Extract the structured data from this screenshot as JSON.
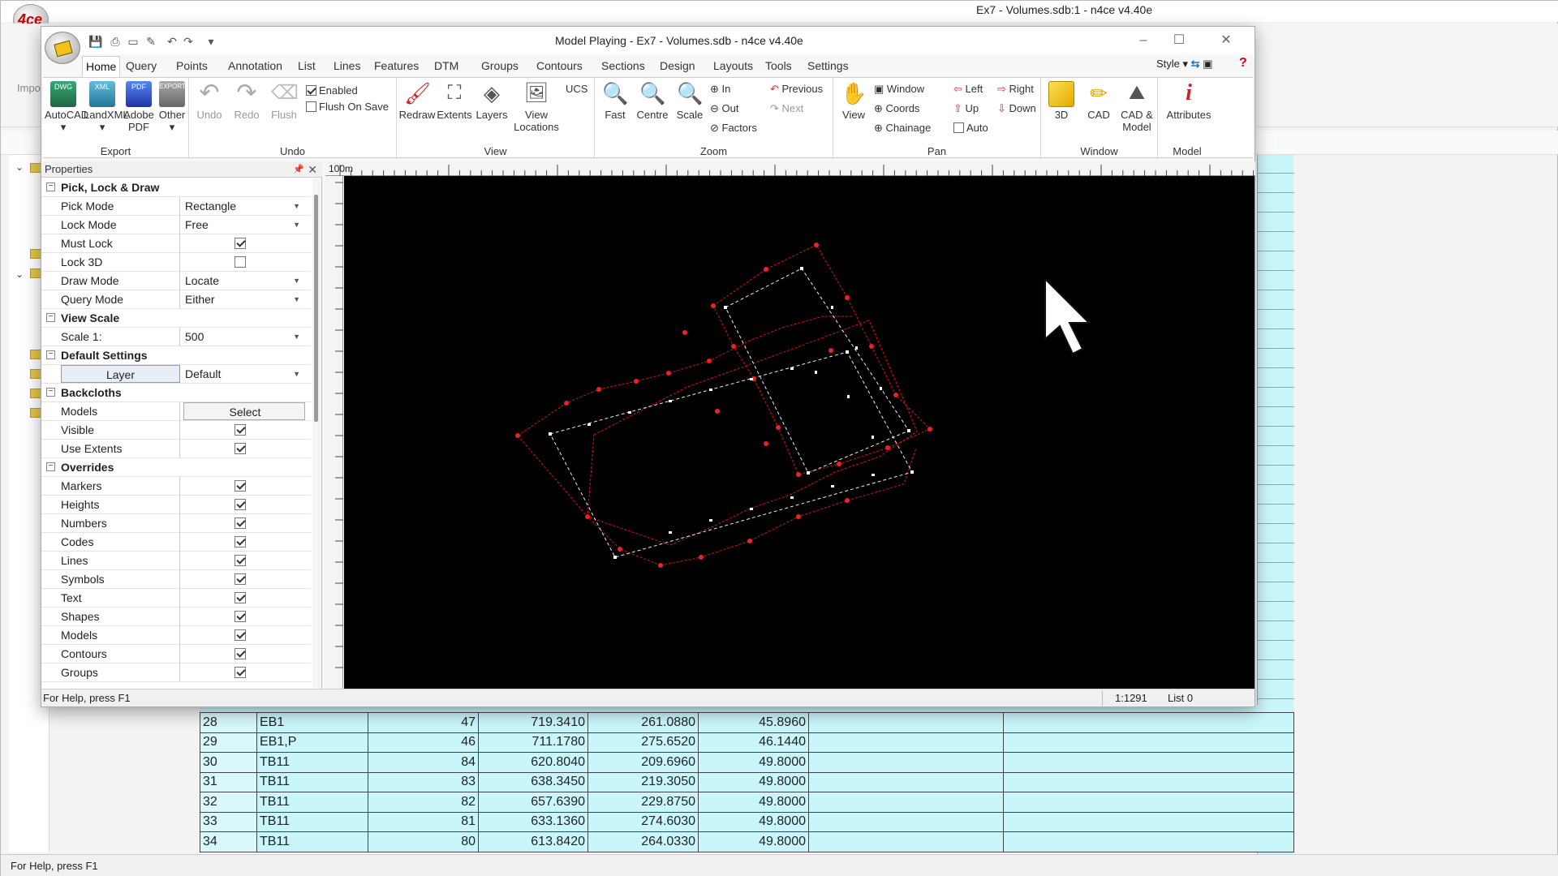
{
  "outer": {
    "title": "Ex7 - Volumes.sdb:1 - n4ce v4.40e",
    "logo_text": "4ce",
    "left_label": "Impo",
    "status": "For Help, press F1"
  },
  "window": {
    "title": "Model Playing - Ex7 - Volumes.sdb - n4ce v4.40e",
    "style_label": "Style",
    "status_left": "For Help, press F1",
    "status_scale": "1:1291",
    "status_list": "List 0"
  },
  "tabs": [
    "Home",
    "Query",
    "Points",
    "Annotation",
    "List",
    "Lines",
    "Features",
    "DTM",
    "Groups",
    "Contours",
    "Sections",
    "Design",
    "Layouts",
    "Tools",
    "Settings"
  ],
  "ribbon": {
    "export": {
      "label": "Export",
      "buttons": [
        "AutoCAD",
        "LandXML",
        "Adobe PDF",
        "Other"
      ],
      "badges": [
        "DWG",
        "XML",
        "PDF",
        "EXPORT"
      ]
    },
    "undo": {
      "label": "Undo",
      "buttons": [
        "Undo",
        "Redo",
        "Flush"
      ],
      "enabled": "Enabled",
      "flush_on_save": "Flush On Save"
    },
    "view": {
      "label": "View",
      "buttons": [
        "Redraw",
        "Extents",
        "Layers",
        "View Locations"
      ],
      "ucs": "UCS"
    },
    "zoom": {
      "label": "Zoom",
      "buttons": [
        "Fast",
        "Centre",
        "Scale"
      ],
      "small": [
        "In",
        "Out",
        "Factors",
        "Previous",
        "Next"
      ]
    },
    "pan": {
      "label": "Pan",
      "buttons": [
        "View"
      ],
      "small": [
        "Window",
        "Coords",
        "Chainage",
        "Left",
        "Up",
        "Auto",
        "Right",
        "Down"
      ]
    },
    "window": {
      "label": "Window",
      "buttons": [
        "3D",
        "CAD",
        "CAD & Model"
      ]
    },
    "model": {
      "label": "Model",
      "buttons": [
        "Attributes"
      ]
    }
  },
  "properties": {
    "title": "Properties",
    "sections": [
      {
        "name": "Pick, Lock & Draw",
        "rows": [
          {
            "name": "Pick Mode",
            "value": "Rectangle",
            "type": "dropdown"
          },
          {
            "name": "Lock Mode",
            "value": "Free",
            "type": "dropdown"
          },
          {
            "name": "Must Lock",
            "checked": true,
            "type": "check"
          },
          {
            "name": "Lock 3D",
            "checked": false,
            "type": "check"
          },
          {
            "name": "Draw Mode",
            "value": "Locate",
            "type": "dropdown"
          },
          {
            "name": "Query Mode",
            "value": "Either",
            "type": "dropdown"
          }
        ]
      },
      {
        "name": "View Scale",
        "rows": [
          {
            "name": "Scale 1:",
            "value": "500",
            "type": "dropdown"
          }
        ]
      },
      {
        "name": "Default Settings",
        "rows": [
          {
            "name": "Layer",
            "value": "Default",
            "type": "dropdown",
            "style": "layer"
          }
        ]
      },
      {
        "name": "Backcloths",
        "rows": [
          {
            "name": "Models",
            "value": "Select",
            "type": "button"
          },
          {
            "name": "Visible",
            "checked": true,
            "type": "check"
          },
          {
            "name": "Use Extents",
            "checked": true,
            "type": "check"
          }
        ]
      },
      {
        "name": "Overrides",
        "rows": [
          {
            "name": "Markers",
            "checked": true,
            "type": "check"
          },
          {
            "name": "Heights",
            "checked": true,
            "type": "check"
          },
          {
            "name": "Numbers",
            "checked": true,
            "type": "check"
          },
          {
            "name": "Codes",
            "checked": true,
            "type": "check"
          },
          {
            "name": "Lines",
            "checked": true,
            "type": "check"
          },
          {
            "name": "Symbols",
            "checked": true,
            "type": "check"
          },
          {
            "name": "Text",
            "checked": true,
            "type": "check"
          },
          {
            "name": "Shapes",
            "checked": true,
            "type": "check"
          },
          {
            "name": "Models",
            "checked": true,
            "type": "check"
          },
          {
            "name": "Contours",
            "checked": true,
            "type": "check"
          },
          {
            "name": "Groups",
            "checked": true,
            "type": "check"
          }
        ]
      }
    ]
  },
  "canvas": {
    "ruler_label": "100m"
  },
  "table": {
    "rows": [
      [
        "28",
        "EB1",
        "47",
        "719.3410",
        "261.0880",
        "45.8960"
      ],
      [
        "29",
        "EB1,P",
        "46",
        "711.1780",
        "275.6520",
        "46.1440"
      ],
      [
        "30",
        "TB11",
        "84",
        "620.8040",
        "209.6960",
        "49.8000"
      ],
      [
        "31",
        "TB11",
        "83",
        "638.3450",
        "219.3050",
        "49.8000"
      ],
      [
        "32",
        "TB11",
        "82",
        "657.6390",
        "229.8750",
        "49.8000"
      ],
      [
        "33",
        "TB11",
        "81",
        "633.1360",
        "274.6030",
        "49.8000"
      ],
      [
        "34",
        "TB11",
        "80",
        "613.8420",
        "264.0330",
        "49.8000"
      ]
    ]
  }
}
